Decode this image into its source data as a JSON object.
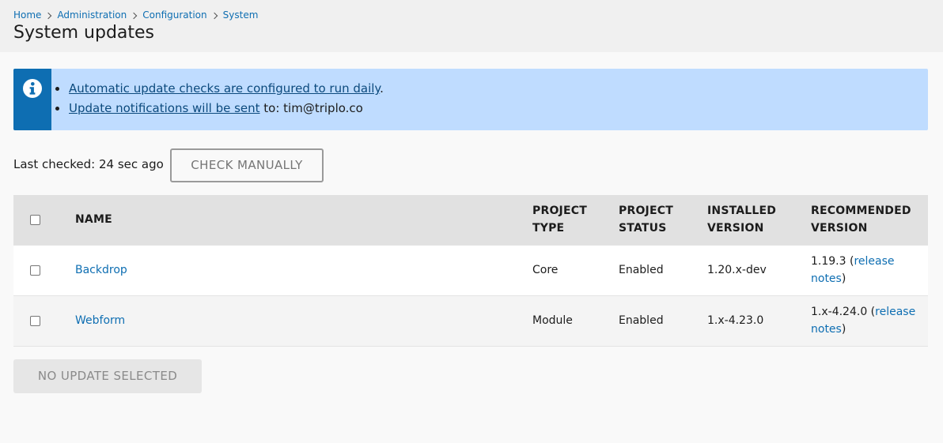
{
  "breadcrumb": [
    "Home",
    "Administration",
    "Configuration",
    "System"
  ],
  "page_title": "System updates",
  "message": {
    "icon": "info-icon",
    "items": [
      {
        "link": "Automatic update checks are configured to run daily",
        "suffix": "."
      },
      {
        "link": "Update notifications will be sent",
        "suffix": " to: tim@triplo.co"
      }
    ]
  },
  "status": {
    "last_checked": "Last checked: 24 sec ago",
    "check_button": "CHECK MANUALLY"
  },
  "table": {
    "headers": {
      "name": "NAME",
      "type_1": "PROJECT",
      "type_2": "TYPE",
      "status_1": "PROJECT",
      "status_2": "STATUS",
      "installed_1": "INSTALLED",
      "installed_2": "VERSION",
      "recommended_1": "RECOMMENDED",
      "recommended_2": "VERSION"
    },
    "rows": [
      {
        "name": "Backdrop",
        "type": "Core",
        "status": "Enabled",
        "installed": "1.20.x-dev",
        "recommended": "1.19.3",
        "notes_1": "release",
        "notes_2": "notes"
      },
      {
        "name": "Webform",
        "type": "Module",
        "status": "Enabled",
        "installed": "1.x-4.23.0",
        "recommended": "1.x-4.24.0",
        "notes_1": "release",
        "notes_2": "notes"
      }
    ]
  },
  "submit_button": "NO UPDATE SELECTED",
  "colors": {
    "link": "#0e6eb2",
    "message_bg": "#bfdcff",
    "message_icon_bg": "#0e6eb2"
  }
}
